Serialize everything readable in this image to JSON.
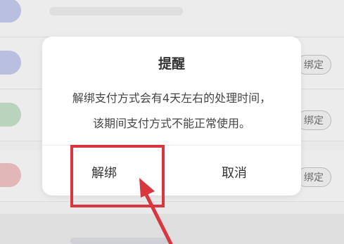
{
  "background": {
    "bind_label": "绑定"
  },
  "dialog": {
    "title": "提醒",
    "message_line1": "解绑支付方式会有4天左右的处理时间，",
    "message_line2": "该期间支付方式不能正常使用。",
    "confirm_label": "解绑",
    "cancel_label": "取消"
  },
  "colors": {
    "annotation": "#d9363e",
    "dialog_bg": "#ffffff",
    "text": "#333333"
  }
}
